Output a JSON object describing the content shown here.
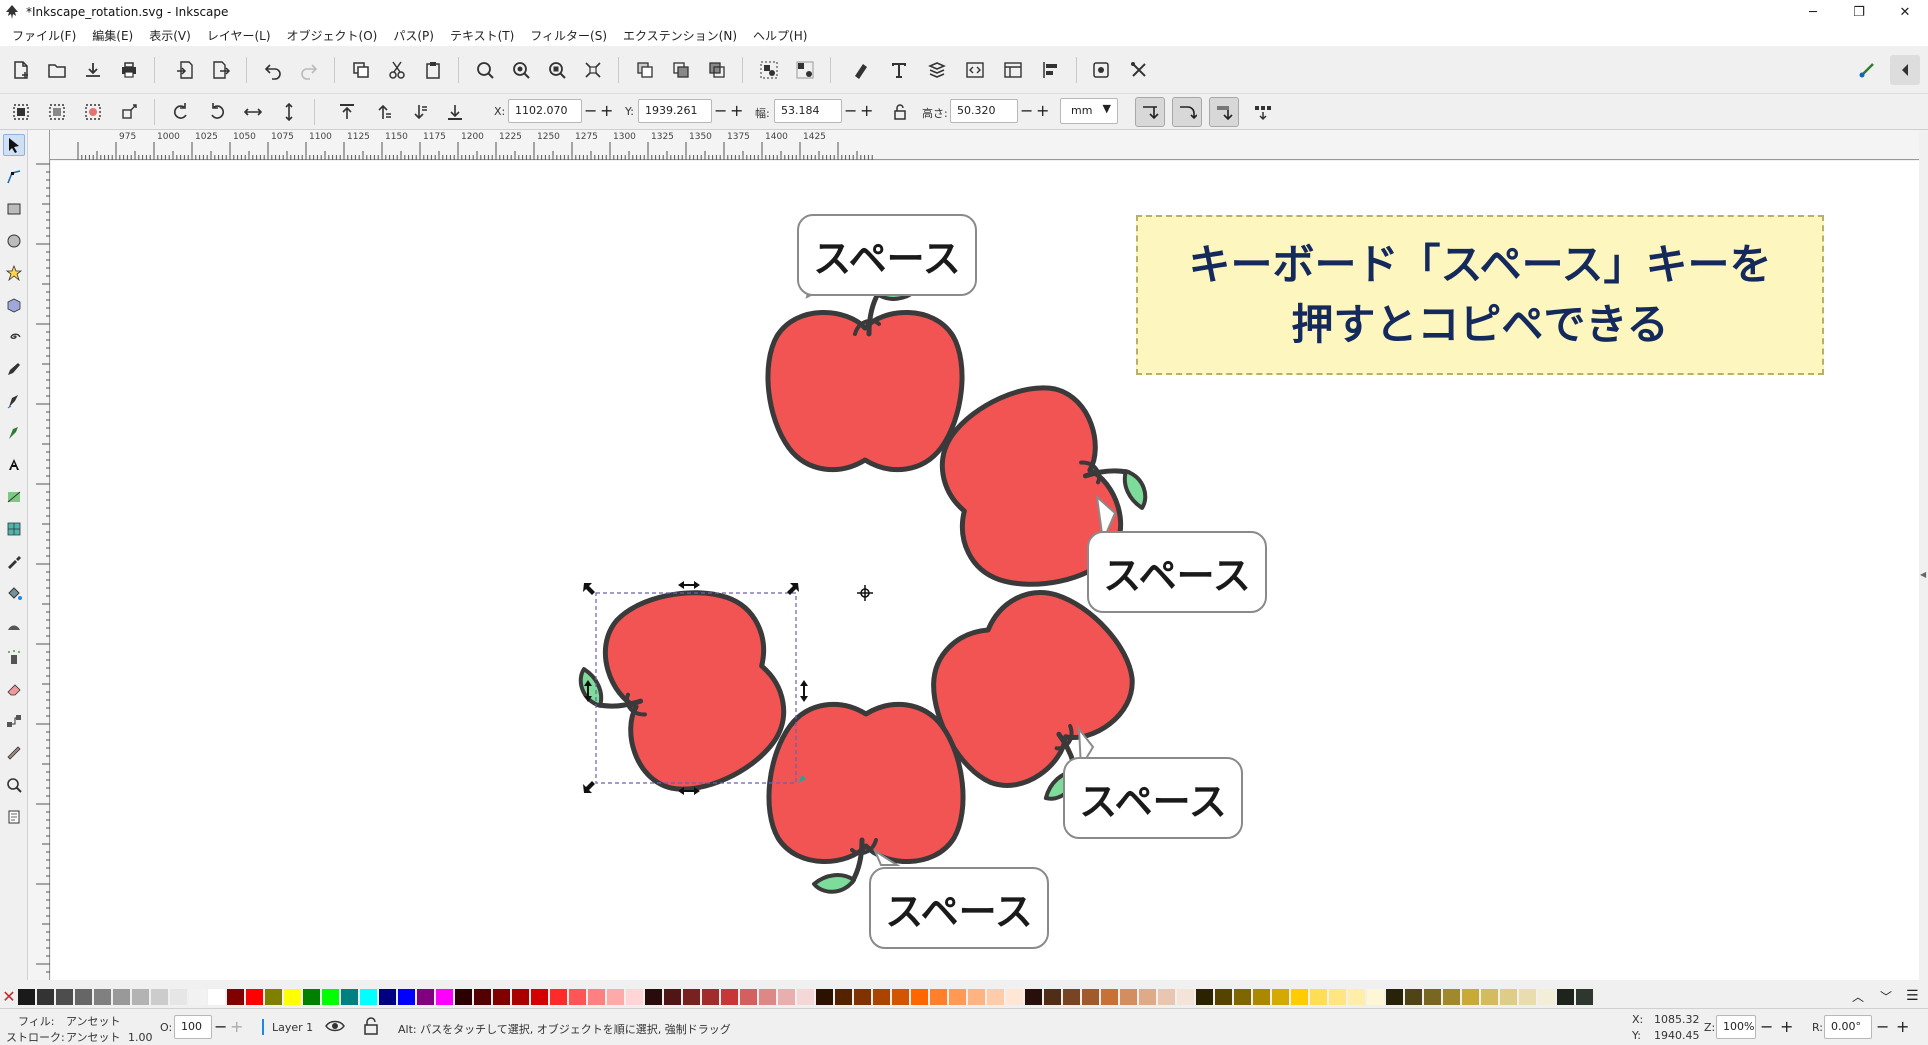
{
  "window": {
    "title": "*Inkscape_rotation.svg - Inkscape",
    "buttons": {
      "minimize": "─",
      "maximize": "❐",
      "close": "✕"
    }
  },
  "menu": [
    "ファイル(F)",
    "編集(E)",
    "表示(V)",
    "レイヤー(L)",
    "オブジェクト(O)",
    "パス(P)",
    "テキスト(T)",
    "フィルター(S)",
    "エクステンション(N)",
    "ヘルプ(H)"
  ],
  "controls": {
    "x_label": "X:",
    "x_value": "1102.070",
    "y_label": "Y:",
    "y_value": "1939.261",
    "w_label": "幅:",
    "w_value": "53.184",
    "h_label": "高さ:",
    "h_value": "50.320",
    "unit": "mm"
  },
  "ruler": {
    "h_labels": [
      "975",
      "1000",
      "1025",
      "1050",
      "1075",
      "1100",
      "1125",
      "1150",
      "1175",
      "1200",
      "1225",
      "1250",
      "1275",
      "1300",
      "1325",
      "1350",
      "1375",
      "1400",
      "1425"
    ]
  },
  "canvas": {
    "banner_line1": "キーボード「スペース」キーを",
    "banner_line2": "押すとコピペできる",
    "bubbles": [
      "スペース",
      "スペース",
      "スペース",
      "スペース"
    ]
  },
  "colors": {
    "apple": "#f25454",
    "apple_outline": "#3a3a3a",
    "leaf": "#7ddc9a",
    "banner_bg": "#fdf6bf",
    "banner_text": "#142a5c",
    "selection": "#6a5fb0"
  },
  "status": {
    "fill_label": "フィル:",
    "fill_value": "アンセット",
    "stroke_label": "ストローク:",
    "stroke_value": "アンセット",
    "stroke_width": "1.00",
    "opacity_label": "O:",
    "opacity_value": "100",
    "layer": "Layer 1",
    "message": "Alt: パスをタッチして選択, オブジェクトを順に選択, 強制ドラッグ",
    "cursor_x_label": "X:",
    "cursor_x": "1085.32",
    "cursor_y_label": "Y:",
    "cursor_y": "1940.45",
    "zoom_label": "Z:",
    "zoom": "100%",
    "rotate_label": "R:",
    "rotate": "0.00°"
  },
  "palette": [
    "#1a1a1a",
    "#333333",
    "#4d4d4d",
    "#666666",
    "#808080",
    "#999999",
    "#b3b3b3",
    "#cccccc",
    "#e6e6e6",
    "#f2f2f2",
    "#ffffff",
    "#800000",
    "#ff0000",
    "#808000",
    "#ffff00",
    "#008000",
    "#00ff00",
    "#008080",
    "#00ffff",
    "#000080",
    "#0000ff",
    "#800080",
    "#ff00ff",
    "#2b0000",
    "#550000",
    "#800000",
    "#aa0000",
    "#d40000",
    "#ff2a2a",
    "#ff5555",
    "#ff8080",
    "#ffaaaa",
    "#ffd5d5",
    "#280b0b",
    "#501616",
    "#782121",
    "#a02c2c",
    "#c83737",
    "#d35f5f",
    "#de8787",
    "#e9afaf",
    "#f4d7d7",
    "#2b1100",
    "#552200",
    "#803300",
    "#aa4400",
    "#d45500",
    "#ff6600",
    "#ff7f2a",
    "#ff9955",
    "#ffb380",
    "#ffccaa",
    "#ffe6d5",
    "#280f0b",
    "#502d16",
    "#784421",
    "#a05a2c",
    "#c87137",
    "#d38d5f",
    "#deaa87",
    "#e9c6af",
    "#f4e3d7",
    "#2b2200",
    "#554400",
    "#806600",
    "#aa8800",
    "#d4aa00",
    "#ffcc00",
    "#ffdd55",
    "#ffe680",
    "#ffeeaa",
    "#fff6d5",
    "#28220b",
    "#504416",
    "#786721",
    "#a0892c",
    "#c8ab37",
    "#d3bc5f",
    "#decd87",
    "#e9ddaf",
    "#f4eed7",
    "#1c241c",
    "#2d372d"
  ]
}
